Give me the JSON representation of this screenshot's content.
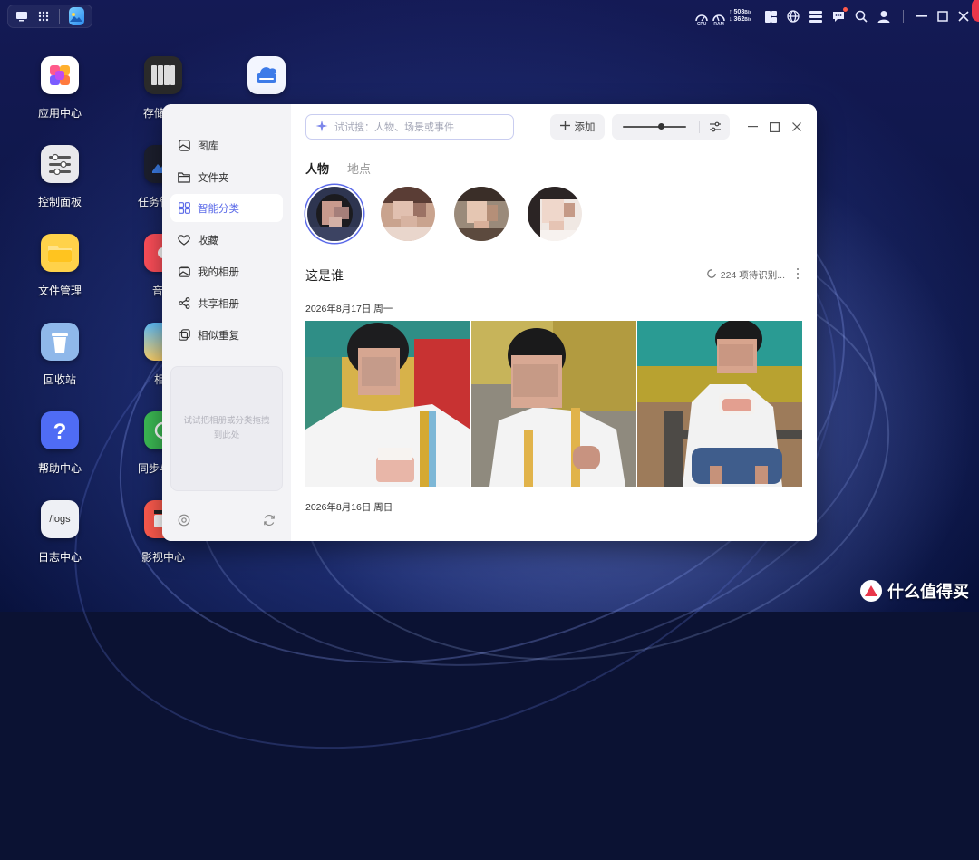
{
  "topbar": {
    "cpu_label": "CPU",
    "ram_label": "RAM",
    "net_up": "↑ 508",
    "net_up_unit": "B/s",
    "net_down": "↓ 362",
    "net_down_unit": "B/s"
  },
  "desktop_icons": [
    {
      "label": "应用中心"
    },
    {
      "label": "存储"
    },
    {
      "label": "控制面板"
    },
    {
      "label": "任务管"
    },
    {
      "label": "文件管理"
    },
    {
      "label": "音"
    },
    {
      "label": "回收站"
    },
    {
      "label": "相"
    },
    {
      "label": "帮助中心"
    },
    {
      "label": "同步与"
    },
    {
      "label": "日志中心"
    },
    {
      "label": "影视中心"
    }
  ],
  "logs_icon_text": "/logs",
  "sidebar": {
    "items": [
      {
        "label": "图库",
        "icon": "gallery-icon"
      },
      {
        "label": "文件夹",
        "icon": "folder-icon"
      },
      {
        "label": "智能分类",
        "icon": "smart-grid-icon"
      },
      {
        "label": "收藏",
        "icon": "heart-icon"
      },
      {
        "label": "我的相册",
        "icon": "album-icon"
      },
      {
        "label": "共享相册",
        "icon": "share-icon"
      },
      {
        "label": "相似重复",
        "icon": "duplicate-icon"
      }
    ],
    "active_index": 2,
    "dropzone_text": "试试把相册或分类拖拽到此处"
  },
  "toolbar": {
    "search_placeholder": "试试搜：人物、场景或事件",
    "add_label": "添加",
    "zoom_level": 0.6
  },
  "tabs": [
    {
      "label": "人物",
      "active": true
    },
    {
      "label": "地点",
      "active": false
    }
  ],
  "section": {
    "title": "这是谁",
    "pending_text": "224 项待识别..."
  },
  "groups": [
    {
      "date": "2026年8月17日 周一"
    },
    {
      "date": "2026年8月16日 周日"
    }
  ],
  "colors": {
    "accent": "#5b6ae8",
    "brand_watermark": "#ffffff"
  },
  "watermark": {
    "text": "什么值得买"
  }
}
